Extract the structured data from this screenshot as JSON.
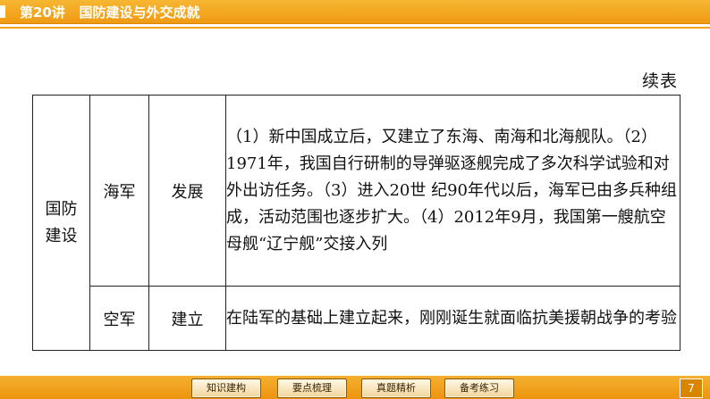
{
  "header": {
    "title": "第20讲   国防建设与外交成就"
  },
  "continued_label": "续表",
  "table": {
    "category": "国防建设",
    "rows": [
      {
        "branch": "海军",
        "aspect": "发展",
        "text": "（1）新中国成立后，又建立了东海、南海和北海舰队。（2）1971年，我国自行研制的导弹驱逐舰完成了多次科学试验和对外出访任务。（3）进入20世  纪90年代以后，海军已由多兵种组成，活动范围也逐步扩大。（4）2012年9月，我国第一艘航空母舰“辽宁舰”交接入列"
      },
      {
        "branch": "空军",
        "aspect": "建立",
        "text": "在陆军的基础上建立起来，刚刚诞生就面临抗美援朝战争的考验"
      }
    ]
  },
  "footer": {
    "nav": [
      "知识建构",
      "要点梳理",
      "真题精析",
      "备考练习"
    ],
    "page": "7"
  }
}
